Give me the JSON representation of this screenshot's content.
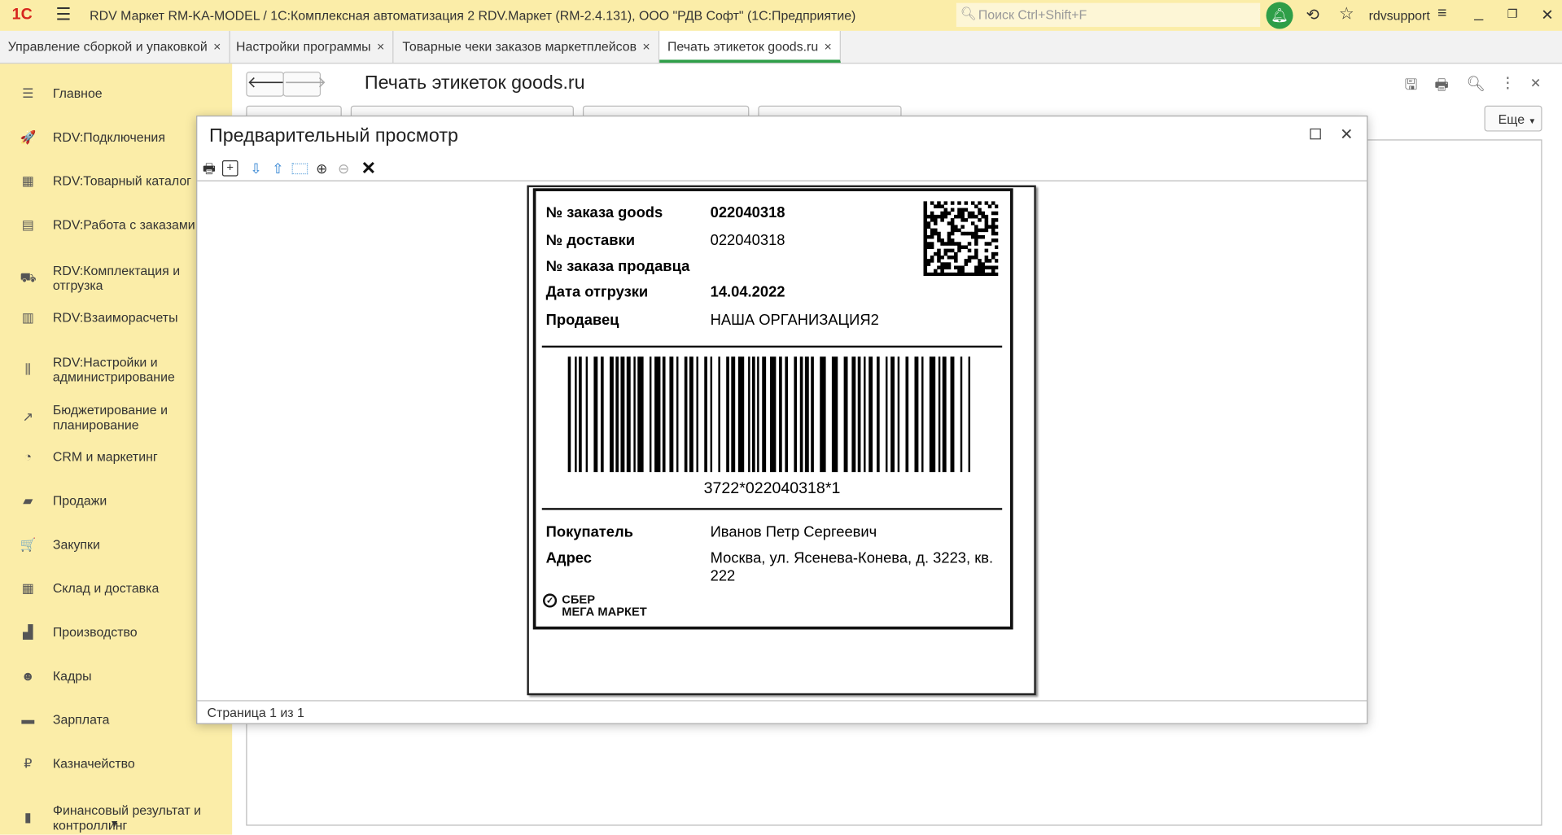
{
  "window": {
    "title": "RDV Маркет RM-KA-MODEL / 1С:Комплексная автоматизация 2 RDV.Маркет (RM-2.4.131), ООО \"РДВ Софт\"  (1С:Предприятие)",
    "search_placeholder": "Поиск Ctrl+Shift+F",
    "user": "rdvsupport",
    "logo": "1С"
  },
  "tabs": [
    {
      "label": "Управление сборкой и упаковкой"
    },
    {
      "label": "Настройки программы"
    },
    {
      "label": "Товарные чеки заказов маркетплейсов"
    },
    {
      "label": "Печать этикеток goods.ru"
    }
  ],
  "tab_close": "×",
  "sidebar": [
    {
      "label": "Главное",
      "icon": "☰"
    },
    {
      "label": "RDV:Подключения",
      "icon": "🚀"
    },
    {
      "label": "RDV:Товарный каталог",
      "icon": "▦"
    },
    {
      "label": "RDV:Работа с заказами",
      "icon": "▤"
    },
    {
      "label": "RDV:Комплектация и отгрузка",
      "icon": "⛟"
    },
    {
      "label": "RDV:Взаиморасчеты",
      "icon": "▥"
    },
    {
      "label": "RDV:Настройки и администрирование",
      "icon": "⫼"
    },
    {
      "label": "Бюджетирование и планирование",
      "icon": "↗"
    },
    {
      "label": "CRM и маркетинг",
      "icon": "◔"
    },
    {
      "label": "Продажи",
      "icon": "▰"
    },
    {
      "label": "Закупки",
      "icon": "🛒"
    },
    {
      "label": "Склад и доставка",
      "icon": "▦"
    },
    {
      "label": "Производство",
      "icon": "▟"
    },
    {
      "label": "Кадры",
      "icon": "☻"
    },
    {
      "label": "Зарплата",
      "icon": "▬"
    },
    {
      "label": "Казначейство",
      "icon": "₽"
    },
    {
      "label": "Финансовый результат и контроллинг",
      "icon": "▮"
    }
  ],
  "form": {
    "title": "Печать этикеток goods.ru",
    "more_label": "Еще"
  },
  "dialog": {
    "title": "Предварительный просмотр",
    "status": "Страница 1 из 1"
  },
  "label": {
    "rows": [
      {
        "key": "№ заказа goods",
        "value": "022040318",
        "bold": true
      },
      {
        "key": "№ доставки",
        "value": "022040318",
        "bold": false
      },
      {
        "key": "№ заказа продавца",
        "value": "",
        "bold": false
      },
      {
        "key": "Дата отгрузки",
        "value": "14.04.2022",
        "bold": true
      },
      {
        "key": "Продавец",
        "value": "НАША ОРГАНИЗАЦИЯ2",
        "bold": false
      }
    ],
    "barcode_text": "3722*022040318*1",
    "buyer_key": "Покупатель",
    "buyer": "Иванов Петр Сергеевич",
    "address_key": "Адрес",
    "address": "Москва, ул. Ясенева-Конева, д. 3223, кв. 222",
    "logo_line1": "СБЕР",
    "logo_line2": "МЕГА МАРКЕТ"
  }
}
